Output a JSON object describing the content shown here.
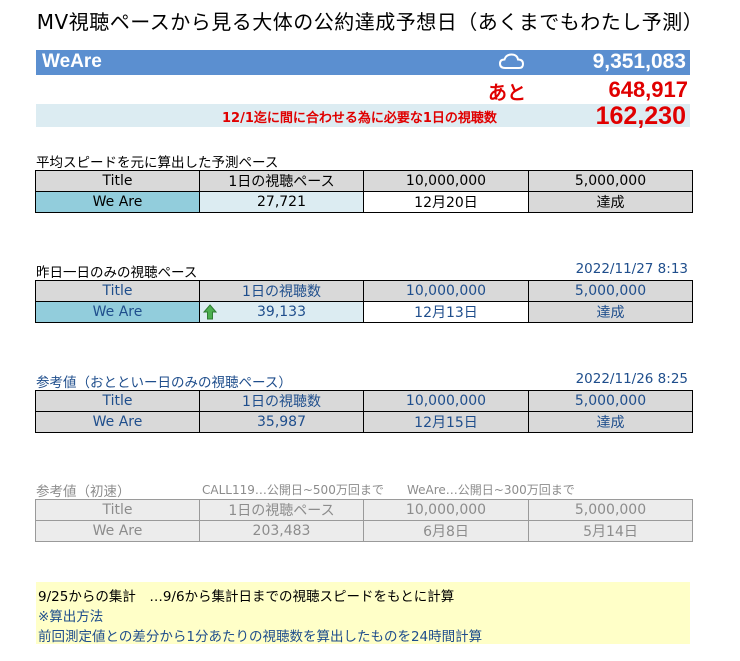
{
  "page_title": "MV視聴ペースから見る大体の公約達成予想日（あくまでもわたし予測）",
  "banner": {
    "name": "WeAre",
    "icon": "cloud-icon",
    "count": "9,351,083",
    "bg_color": "#5b8fd0"
  },
  "remaining": {
    "label": "あと",
    "value": "648,917"
  },
  "required": {
    "label": "12/1迄に間に合わせる為に必要な1日の視聴数",
    "value": "162,230"
  },
  "section_avg": {
    "label": "平均スピードを元に算出した予測ペース",
    "headers": [
      "Title",
      "1日の視聴ペース",
      "10,000,000",
      "5,000,000"
    ],
    "row": [
      "We Are",
      "27,721",
      "12月20日",
      "達成"
    ]
  },
  "section_yesterday": {
    "label": "昨日一日のみの視聴ペース",
    "timestamp": "2022/11/27 8:13",
    "headers": [
      "Title",
      "1日の視聴数",
      "10,000,000",
      "5,000,000"
    ],
    "row": [
      "We Are",
      "39,133",
      "12月13日",
      "達成"
    ],
    "trend_icon": "up-arrow-icon",
    "trend_color": "#4caf50"
  },
  "section_daybefore": {
    "label": "参考値（おとといー日のみの視聴ペース）",
    "timestamp": "2022/11/26 8:25",
    "headers": [
      "Title",
      "1日の視聴数",
      "10,000,000",
      "5,000,000"
    ],
    "row": [
      "We Are",
      "35,987",
      "12月15日",
      "達成"
    ]
  },
  "section_initial": {
    "label": "参考値（初速）",
    "note1": "CALL119…公開日~500万回まで",
    "note2": "WeAre…公開日~300万回まで",
    "headers": [
      "Title",
      "1日の視聴ペース",
      "10,000,000",
      "5,000,000"
    ],
    "row": [
      "We Are",
      "203,483",
      "6月8日",
      "5月14日"
    ]
  },
  "footer_note": {
    "line1": "9/25からの集計　…9/6から集計日までの視聴スピードをもとに計算",
    "line2": "※算出方法",
    "line3": "前回測定値との差分から1分あたりの視聴数を算出したものを24時間計算"
  }
}
